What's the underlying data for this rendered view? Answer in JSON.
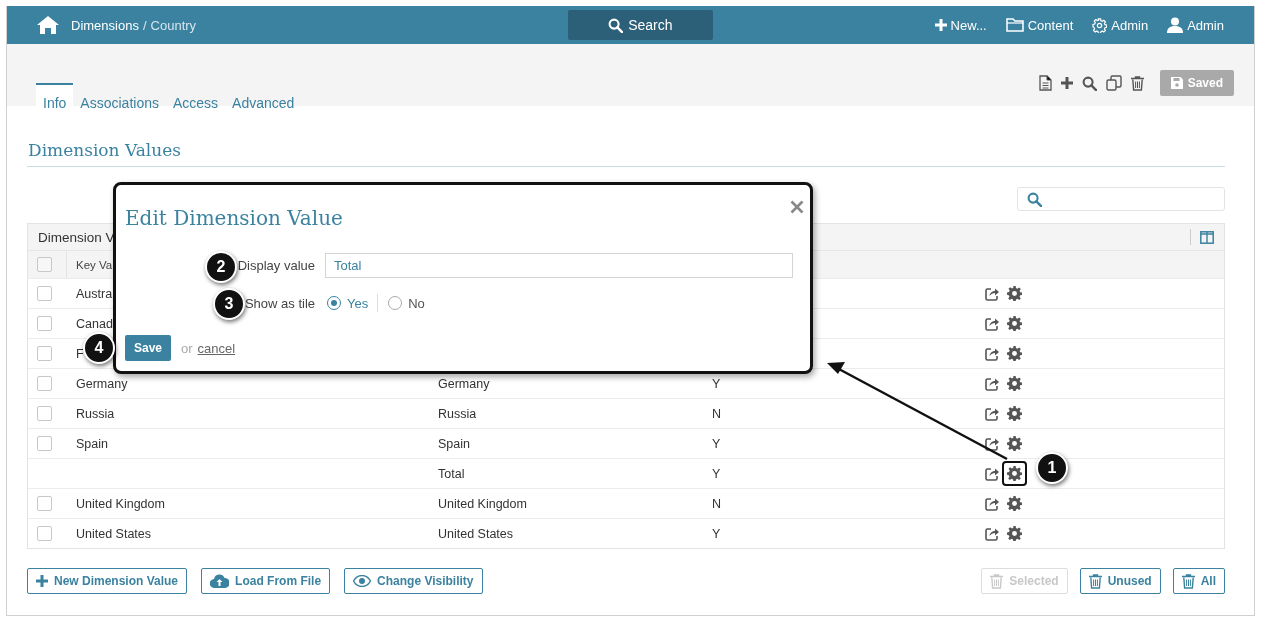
{
  "topbar": {
    "breadcrumb": "Dimensions",
    "separator": "/",
    "current": "Country",
    "search": "Search",
    "actions": [
      {
        "label": "New..."
      },
      {
        "label": "Content"
      },
      {
        "label": "Admin"
      },
      {
        "label": "Admin"
      }
    ]
  },
  "tabs": [
    {
      "label": "Info",
      "selected": true
    },
    {
      "label": "Associations",
      "selected": false
    },
    {
      "label": "Access",
      "selected": false
    },
    {
      "label": "Advanced",
      "selected": false
    }
  ],
  "toolbar": {
    "save_button": {
      "label": "Saved",
      "disabled": true
    }
  },
  "section_title": "Dimension Values",
  "table": {
    "title": "Dimension V",
    "key_header": "Key Va",
    "all_checked": false,
    "rows": [
      {
        "kind": "value",
        "key": "Austra",
        "checked": false
      },
      {
        "kind": "value",
        "key": "Canad",
        "checked": false
      },
      {
        "kind": "value",
        "key": "F",
        "checked": false
      },
      {
        "kind": "value",
        "key": "Germany",
        "display": "Germany",
        "tile": "Y",
        "checked": false
      },
      {
        "kind": "value",
        "key": "Russia",
        "display": "Russia",
        "tile": "N",
        "checked": false
      },
      {
        "kind": "value",
        "key": "Spain",
        "display": "Spain",
        "tile": "Y",
        "checked": false
      },
      {
        "kind": "total",
        "display": "Total",
        "tile": "Y",
        "highlight": true,
        "step": "1"
      },
      {
        "kind": "value",
        "key": "United Kingdom",
        "display": "United Kingdom",
        "tile": "N",
        "checked": false
      },
      {
        "kind": "value",
        "key": "United States",
        "display": "United States",
        "tile": "Y",
        "checked": false
      }
    ]
  },
  "footer": {
    "left": [
      {
        "label": "New Dimension Value",
        "disabled": false
      },
      {
        "label": "Load From File",
        "disabled": false
      },
      {
        "label": "Change Visibility",
        "disabled": false
      }
    ],
    "right": [
      {
        "label": "Selected",
        "disabled": true
      },
      {
        "label": "Unused",
        "disabled": false
      },
      {
        "label": "All",
        "disabled": false
      }
    ]
  },
  "modal": {
    "title": "Edit Dimension Value",
    "display_label": "Display value",
    "display_value": "Total",
    "display_step": "2",
    "tile_label": "Show as tile",
    "tile_step": "3",
    "options": [
      {
        "label": "Yes",
        "selected": true
      },
      {
        "label": "No",
        "selected": false
      }
    ],
    "save": "Save",
    "save_step": "4",
    "or": "or",
    "cancel": "cancel"
  }
}
